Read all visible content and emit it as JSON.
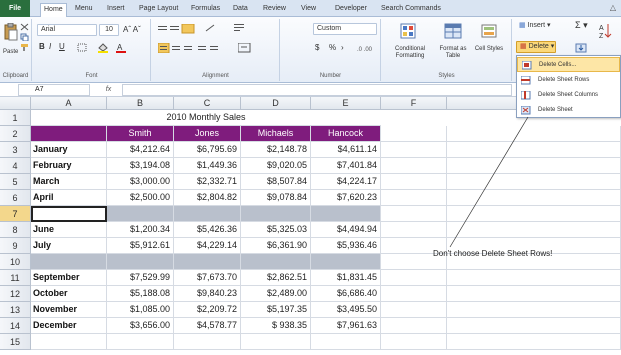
{
  "tabs": [
    "File",
    "Home",
    "Menu",
    "Insert",
    "Page Layout",
    "Formulas",
    "Data",
    "Review",
    "View",
    "Developer",
    "Search Commands"
  ],
  "ribbon": {
    "clipboard": {
      "paste": "Paste",
      "label": "Clipboard"
    },
    "font": {
      "name": "Arial",
      "size": "10",
      "label": "Font",
      "bold": "B",
      "italic": "I",
      "underline": "U"
    },
    "alignment": {
      "label": "Alignment"
    },
    "number": {
      "format": "Custom",
      "currency": "$",
      "percent": "%",
      "label": "Number"
    },
    "styles": {
      "conditional": "Conditional Formatting",
      "format_table": "Format as Table",
      "cell_styles": "Cell Styles",
      "label": "Styles"
    },
    "cells": {
      "insert": "Insert",
      "delete": "Delete"
    }
  },
  "delete_menu": {
    "items": [
      "Delete Cells...",
      "Delete Sheet Rows",
      "Delete Sheet Columns",
      "Delete Sheet"
    ]
  },
  "formula_bar": {
    "name_box": "A7",
    "fx": "fx"
  },
  "columns": [
    "A",
    "B",
    "C",
    "D",
    "E",
    "F",
    "G"
  ],
  "rows": [
    "1",
    "2",
    "3",
    "4",
    "5",
    "6",
    "7",
    "8",
    "9",
    "10",
    "11",
    "12",
    "13",
    "14",
    "15"
  ],
  "sheet": {
    "title": "2010 Monthly Sales",
    "headers": [
      "",
      "Smith",
      "Jones",
      "Michaels",
      "Hancock"
    ],
    "data": [
      {
        "row": "3",
        "month": "January",
        "values": [
          "$4,212.64",
          "$6,795.69",
          "$2,148.78",
          "$4,611.14"
        ]
      },
      {
        "row": "4",
        "month": "February",
        "values": [
          "$3,194.08",
          "$1,449.36",
          "$9,020.05",
          "$7,401.84"
        ]
      },
      {
        "row": "5",
        "month": "March",
        "values": [
          "$3,000.00",
          "$2,332.71",
          "$8,507.84",
          "$4,224.17"
        ]
      },
      {
        "row": "6",
        "month": "April",
        "values": [
          "$2,500.00",
          "$2,804.82",
          "$9,078.84",
          "$7,620.23"
        ]
      },
      {
        "row": "8",
        "month": "June",
        "values": [
          "$1,200.34",
          "$5,426.36",
          "$5,325.03",
          "$4,494.94"
        ]
      },
      {
        "row": "9",
        "month": "July",
        "values": [
          "$5,912.61",
          "$4,229.14",
          "$6,361.90",
          "$5,936.46"
        ]
      },
      {
        "row": "11",
        "month": "September",
        "values": [
          "$7,529.99",
          "$7,673.70",
          "$2,862.51",
          "$1,831.45"
        ]
      },
      {
        "row": "12",
        "month": "October",
        "values": [
          "$5,188.08",
          "$9,840.23",
          "$2,489.00",
          "$6,686.40"
        ]
      },
      {
        "row": "13",
        "month": "November",
        "values": [
          "$1,085.00",
          "$2,209.72",
          "$5,197.35",
          "$3,495.50"
        ]
      },
      {
        "row": "14",
        "month": "December",
        "values": [
          "$3,656.00",
          "$4,578.77",
          "$   938.35",
          "$7,961.63"
        ]
      }
    ]
  },
  "callout": "Don't choose Delete Sheet Rows!",
  "colors": {
    "header_bg": "#7f1c7d",
    "grey_row": "#b9c0cc",
    "highlight": "#fde6a6",
    "file_tab": "#2a6f3d"
  }
}
